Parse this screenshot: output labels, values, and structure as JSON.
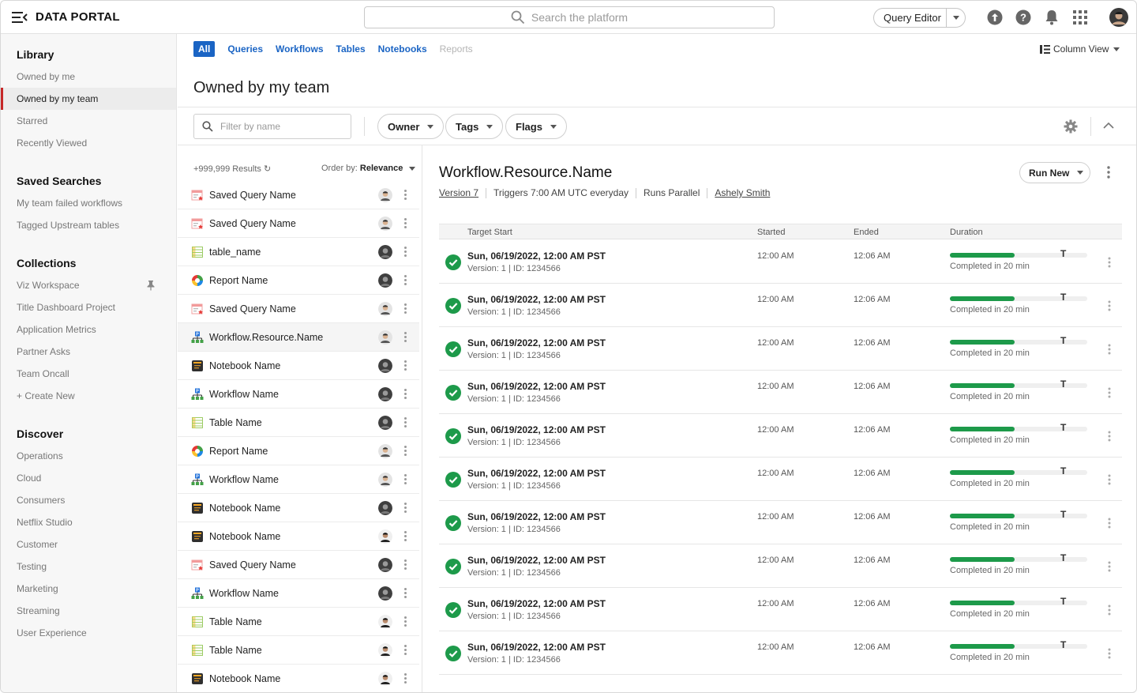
{
  "app": {
    "brand": "DATA PORTAL",
    "search_placeholder": "Search the platform",
    "query_editor": "Query Editor"
  },
  "sidebar": {
    "library": {
      "title": "Library",
      "items": [
        "Owned by me",
        "Owned by my team",
        "Starred",
        "Recently Viewed"
      ],
      "active": "Owned by my team"
    },
    "saved_searches": {
      "title": "Saved Searches",
      "items": [
        "My team failed workflows",
        "Tagged Upstream tables"
      ]
    },
    "collections": {
      "title": "Collections",
      "items": [
        "Viz Workspace",
        "Title Dashboard Project",
        "Application Metrics",
        "Partner Asks",
        "Team Oncall",
        "+ Create New"
      ]
    },
    "discover": {
      "title": "Discover",
      "items": [
        "Operations",
        "Cloud",
        "Consumers",
        "Netflix Studio",
        "Customer",
        "Testing",
        "Marketing",
        "Streaming",
        "User Experience"
      ]
    }
  },
  "tabs": [
    "All",
    "Queries",
    "Workflows",
    "Tables",
    "Notebooks",
    "Reports"
  ],
  "view_toggle": "Column View",
  "page_title": "Owned by my team",
  "filter": {
    "placeholder": "Filter by name",
    "pills": [
      "Owner",
      "Tags",
      "Flags"
    ]
  },
  "list": {
    "results": "+999,999 Results",
    "order_label": "Order by:",
    "order_value": "Relevance",
    "items": [
      {
        "name": "Saved Query Name",
        "type": "query",
        "avatar": "light"
      },
      {
        "name": "Saved Query Name",
        "type": "query",
        "avatar": "light"
      },
      {
        "name": "table_name",
        "type": "table",
        "avatar": "dark"
      },
      {
        "name": "Report Name",
        "type": "report",
        "avatar": "dark"
      },
      {
        "name": "Saved Query Name",
        "type": "query",
        "avatar": "light"
      },
      {
        "name": "Workflow.Resource.Name",
        "type": "workflow",
        "avatar": "light"
      },
      {
        "name": "Notebook Name",
        "type": "notebook",
        "avatar": "dark"
      },
      {
        "name": "Workflow Name",
        "type": "workflow",
        "avatar": "dark"
      },
      {
        "name": "Table Name",
        "type": "table",
        "avatar": "dark"
      },
      {
        "name": "Report Name",
        "type": "report",
        "avatar": "light"
      },
      {
        "name": "Workflow Name",
        "type": "workflow",
        "avatar": "light"
      },
      {
        "name": "Notebook Name",
        "type": "notebook",
        "avatar": "dark"
      },
      {
        "name": "Notebook Name",
        "type": "notebook",
        "avatar": "mid"
      },
      {
        "name": "Saved Query Name",
        "type": "query",
        "avatar": "dark"
      },
      {
        "name": "Workflow Name",
        "type": "workflow",
        "avatar": "dark"
      },
      {
        "name": "Table Name",
        "type": "table",
        "avatar": "mid"
      },
      {
        "name": "Table Name",
        "type": "table",
        "avatar": "mid"
      },
      {
        "name": "Notebook Name",
        "type": "notebook",
        "avatar": "mid"
      }
    ]
  },
  "detail": {
    "title": "Workflow.Resource.Name",
    "version": "Version 7",
    "trigger": "Triggers 7:00 AM UTC everyday",
    "mode": "Runs Parallel",
    "owner": "Ashely Smith",
    "run_new": "Run New",
    "columns": [
      "Target Start",
      "Started",
      "Ended",
      "Duration"
    ],
    "runs": [
      {
        "date": "Sun, 06/19/2022, 12:00 AM PST",
        "version": "Version: 1 | ID: 1234566",
        "started": "12:00 AM",
        "ended": "12:06 AM",
        "progress": 0.47,
        "duration": "Completed in 20 min"
      },
      {
        "date": "Sun, 06/19/2022, 12:00 AM PST",
        "version": "Version: 1 | ID: 1234566",
        "started": "12:00 AM",
        "ended": "12:06 AM",
        "progress": 0.47,
        "duration": "Completed in 20 min"
      },
      {
        "date": "Sun, 06/19/2022, 12:00 AM PST",
        "version": "Version: 1 | ID: 1234566",
        "started": "12:00 AM",
        "ended": "12:06 AM",
        "progress": 0.47,
        "duration": "Completed in 20 min"
      },
      {
        "date": "Sun, 06/19/2022, 12:00 AM PST",
        "version": "Version: 1 | ID: 1234566",
        "started": "12:00 AM",
        "ended": "12:06 AM",
        "progress": 0.47,
        "duration": "Completed in 20 min"
      },
      {
        "date": "Sun, 06/19/2022, 12:00 AM PST",
        "version": "Version: 1 | ID: 1234566",
        "started": "12:00 AM",
        "ended": "12:06 AM",
        "progress": 0.47,
        "duration": "Completed in 20 min"
      },
      {
        "date": "Sun, 06/19/2022, 12:00 AM PST",
        "version": "Version: 1 | ID: 1234566",
        "started": "12:00 AM",
        "ended": "12:06 AM",
        "progress": 0.47,
        "duration": "Completed in 20 min"
      },
      {
        "date": "Sun, 06/19/2022, 12:00 AM PST",
        "version": "Version: 1 | ID: 1234566",
        "started": "12:00 AM",
        "ended": "12:06 AM",
        "progress": 0.47,
        "duration": "Completed in 20 min"
      },
      {
        "date": "Sun, 06/19/2022, 12:00 AM PST",
        "version": "Version: 1 | ID: 1234566",
        "started": "12:00 AM",
        "ended": "12:06 AM",
        "progress": 0.47,
        "duration": "Completed in 20 min"
      },
      {
        "date": "Sun, 06/19/2022, 12:00 AM PST",
        "version": "Version: 1 | ID: 1234566",
        "started": "12:00 AM",
        "ended": "12:06 AM",
        "progress": 0.47,
        "duration": "Completed in 20 min"
      },
      {
        "date": "Sun, 06/19/2022, 12:00 AM PST",
        "version": "Version: 1 | ID: 1234566",
        "started": "12:00 AM",
        "ended": "12:06 AM",
        "progress": 0.47,
        "duration": "Completed in 20 min"
      }
    ]
  },
  "colors": {
    "accent": "#1a64c4",
    "success": "#1d9a4a",
    "active_marker": "#c62828"
  }
}
